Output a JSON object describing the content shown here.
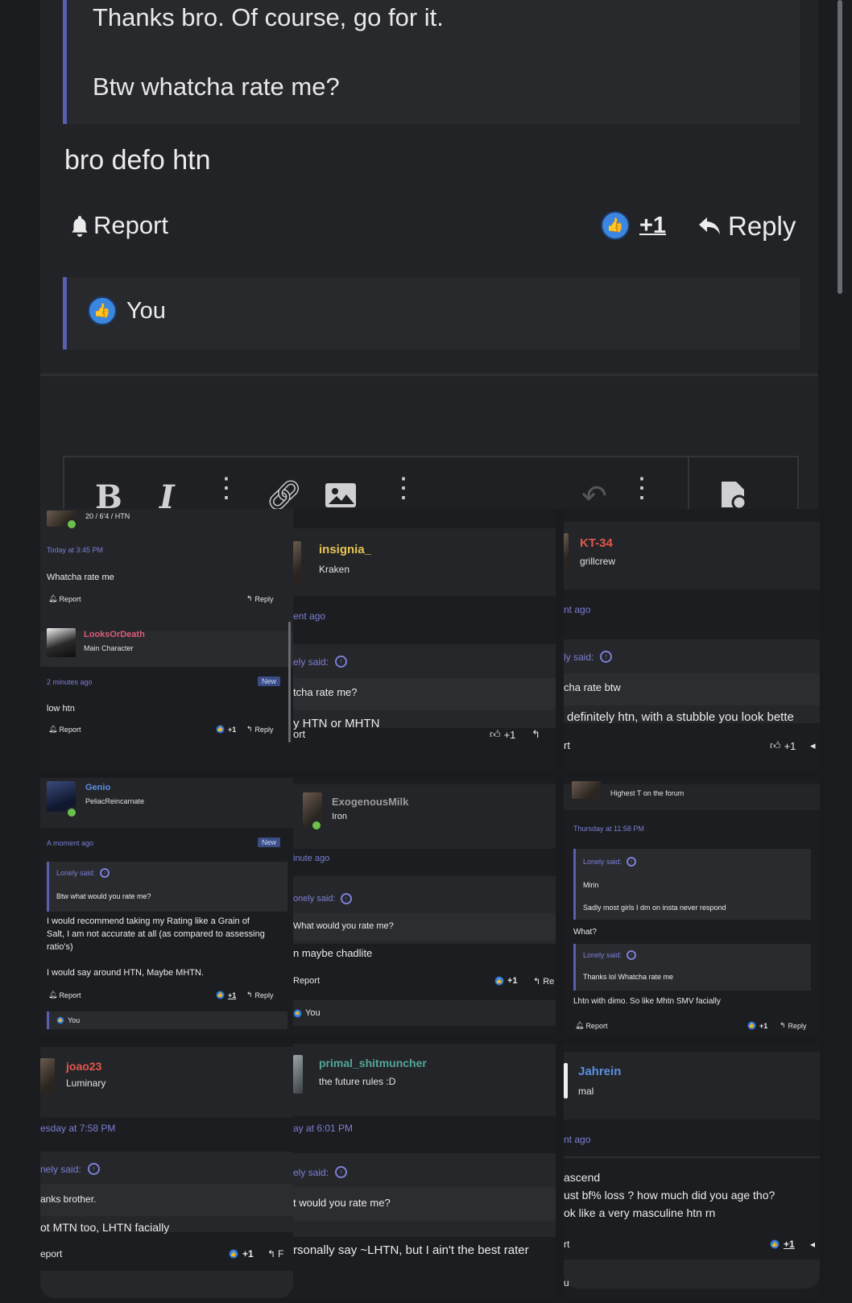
{
  "top_post": {
    "quote_line1": "Thanks bro. Of course, go for it.",
    "quote_line2": "Btw whatcha rate me?",
    "body": "bro defo htn",
    "report": "Report",
    "like_count": "+1",
    "reply": "Reply",
    "reacted_by": "You"
  },
  "tiles": {
    "t1": {
      "user_line": "20 / 6'4 / HTN",
      "time": "Today at 3:45 PM",
      "text": "Whatcha rate me",
      "report": "Report",
      "reply": "Reply",
      "post2_user": "LooksOrDeath",
      "post2_title": "Main Character",
      "post2_time": "2 minutes ago",
      "post2_badge": "New",
      "post2_text": "low htn",
      "post2_report": "Report",
      "post2_like": "+1",
      "post2_reply": "Reply"
    },
    "t2": {
      "user": "insignia_",
      "title": "Kraken",
      "time": "ent ago",
      "said": "ely said:",
      "quote": "tcha rate me?",
      "text": "y HTN or MHTN",
      "report": "ort",
      "like": "+1"
    },
    "t3": {
      "user": "KT-34",
      "title": "grillcrew",
      "time": "nt ago",
      "said": "ly said:",
      "quote": "cha rate btw",
      "text": "definitely htn, with a stubble you look bette",
      "report": "rt",
      "like": "+1"
    },
    "t4": {
      "user": "Genio",
      "title": "PeliacReincarnate",
      "time": "A moment ago",
      "badge": "New",
      "said": "Lonely said:",
      "quote": "Btw what would you rate me?",
      "text1": "I would recommend taking my Rating like a Grain of",
      "text2": "Salt, I am not accurate at all (as compared to assessing",
      "text3": "ratio's)",
      "text4": "I would say around HTN, Maybe MHTN.",
      "report": "Report",
      "like": "+1",
      "reply": "Reply",
      "reacted": "You"
    },
    "t5": {
      "user": "ExogenousMilk",
      "title": "Iron",
      "time": "inute ago",
      "said": "onely said:",
      "quote": "What would you rate me?",
      "text": "n maybe chadlite",
      "report": "Report",
      "like": "+1",
      "reply": "Re",
      "reacted": "You"
    },
    "t6": {
      "title": "Highest T on the forum",
      "time": "Thursday at 11:58 PM",
      "said1": "Lonely said:",
      "quote1a": "Mirin",
      "quote1b": "Sadly most girls I dm on insta never respond",
      "text1": "What?",
      "said2": "Lonely said:",
      "quote2": "Thanks lol Whatcha rate me",
      "text2": "Lhtn with dimo. So like Mhtn SMV facially",
      "report": "Report",
      "like": "+1",
      "reply": "Reply"
    },
    "t7": {
      "user": "joao23",
      "title": "Luminary",
      "time": "esday at 7:58 PM",
      "said": "nely said:",
      "quote": "anks brother.",
      "text": "ot MTN too, LHTN facially",
      "report": "eport",
      "like": "+1",
      "reply": "F"
    },
    "t8": {
      "user": "primal_shitmuncher",
      "title": "the future rules :D",
      "time": "ay at 6:01 PM",
      "said": "ely said:",
      "quote": "t would you rate me?",
      "text": "rsonally say ~LHTN, but I ain't the best rater"
    },
    "t9": {
      "user": "Jahrein",
      "title": "mal",
      "time": "nt ago",
      "text1": "ascend",
      "text2": "ust bf% loss ? how much did you age tho?",
      "text3": "ok like a very masculine htn rn",
      "report": "rt",
      "like": "+1",
      "bottom": "u"
    }
  },
  "colors": {
    "accent": "#7b7fd6",
    "quote_bar": "#5a5fb0",
    "like_blue": "#3b86e0",
    "name_yellow": "#e7c453",
    "name_red": "#e0574d",
    "name_pink": "#d95a78",
    "name_blue": "#5b8fe0",
    "name_grey": "#9b9ba0",
    "name_teal": "#54a69a",
    "name_orange": "#e2574c"
  }
}
